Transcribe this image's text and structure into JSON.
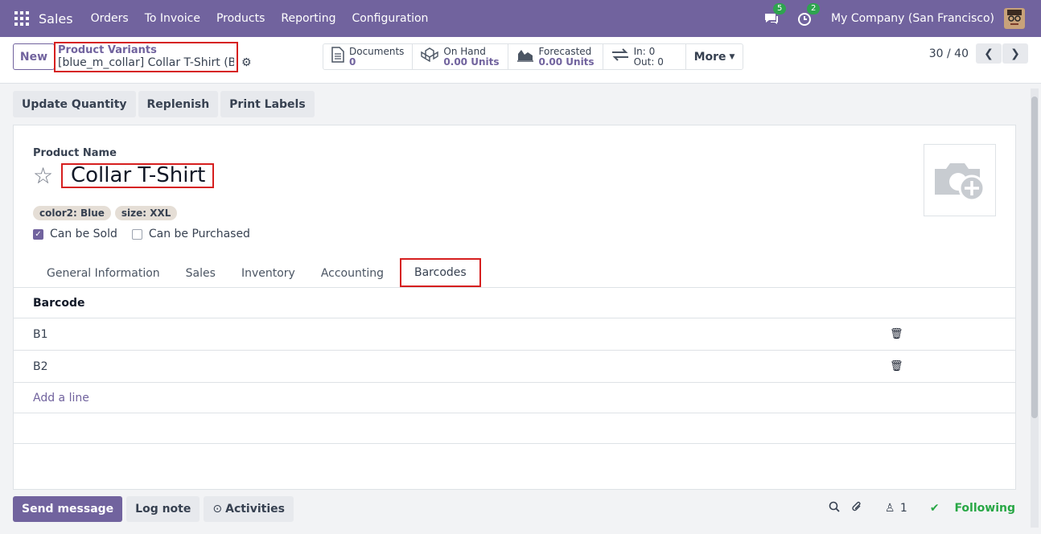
{
  "navbar": {
    "brand": "Sales",
    "menu": [
      "Orders",
      "To Invoice",
      "Products",
      "Reporting",
      "Configuration"
    ],
    "chat_badge": "5",
    "activity_badge": "2",
    "company": "My Company (San Francisco)"
  },
  "control": {
    "new_label": "New",
    "breadcrumb_parent": "Product Variants",
    "breadcrumb_current": "[blue_m_collar] Collar T-Shirt (Bl…",
    "stats": {
      "documents_label": "Documents",
      "documents_value": "0",
      "onhand_label": "On Hand",
      "onhand_value": "0.00 Units",
      "forecast_label": "Forecasted",
      "forecast_value": "0.00 Units",
      "in_label": "In: 0",
      "out_label": "Out: 0",
      "more_label": "More"
    },
    "pager": "30 / 40"
  },
  "actions": [
    "Update Quantity",
    "Replenish",
    "Print Labels"
  ],
  "form": {
    "name_label": "Product Name",
    "name_value": "Collar T-Shirt",
    "tags": [
      "color2: Blue",
      "size: XXL"
    ],
    "can_be_sold": "Can be Sold",
    "can_be_purchased": "Can be Purchased",
    "tabs": [
      "General Information",
      "Sales",
      "Inventory",
      "Accounting",
      "Barcodes"
    ],
    "barcode_header": "Barcode",
    "barcodes": [
      "B1",
      "B2"
    ],
    "add_line": "Add a line"
  },
  "chatter": {
    "send_message": "Send message",
    "log_note": "Log note",
    "activities": "Activities",
    "followers_count": "1",
    "following": "Following"
  },
  "colors": {
    "brand": "#71639e",
    "highlight": "#d61f1f",
    "success": "#28a745"
  }
}
